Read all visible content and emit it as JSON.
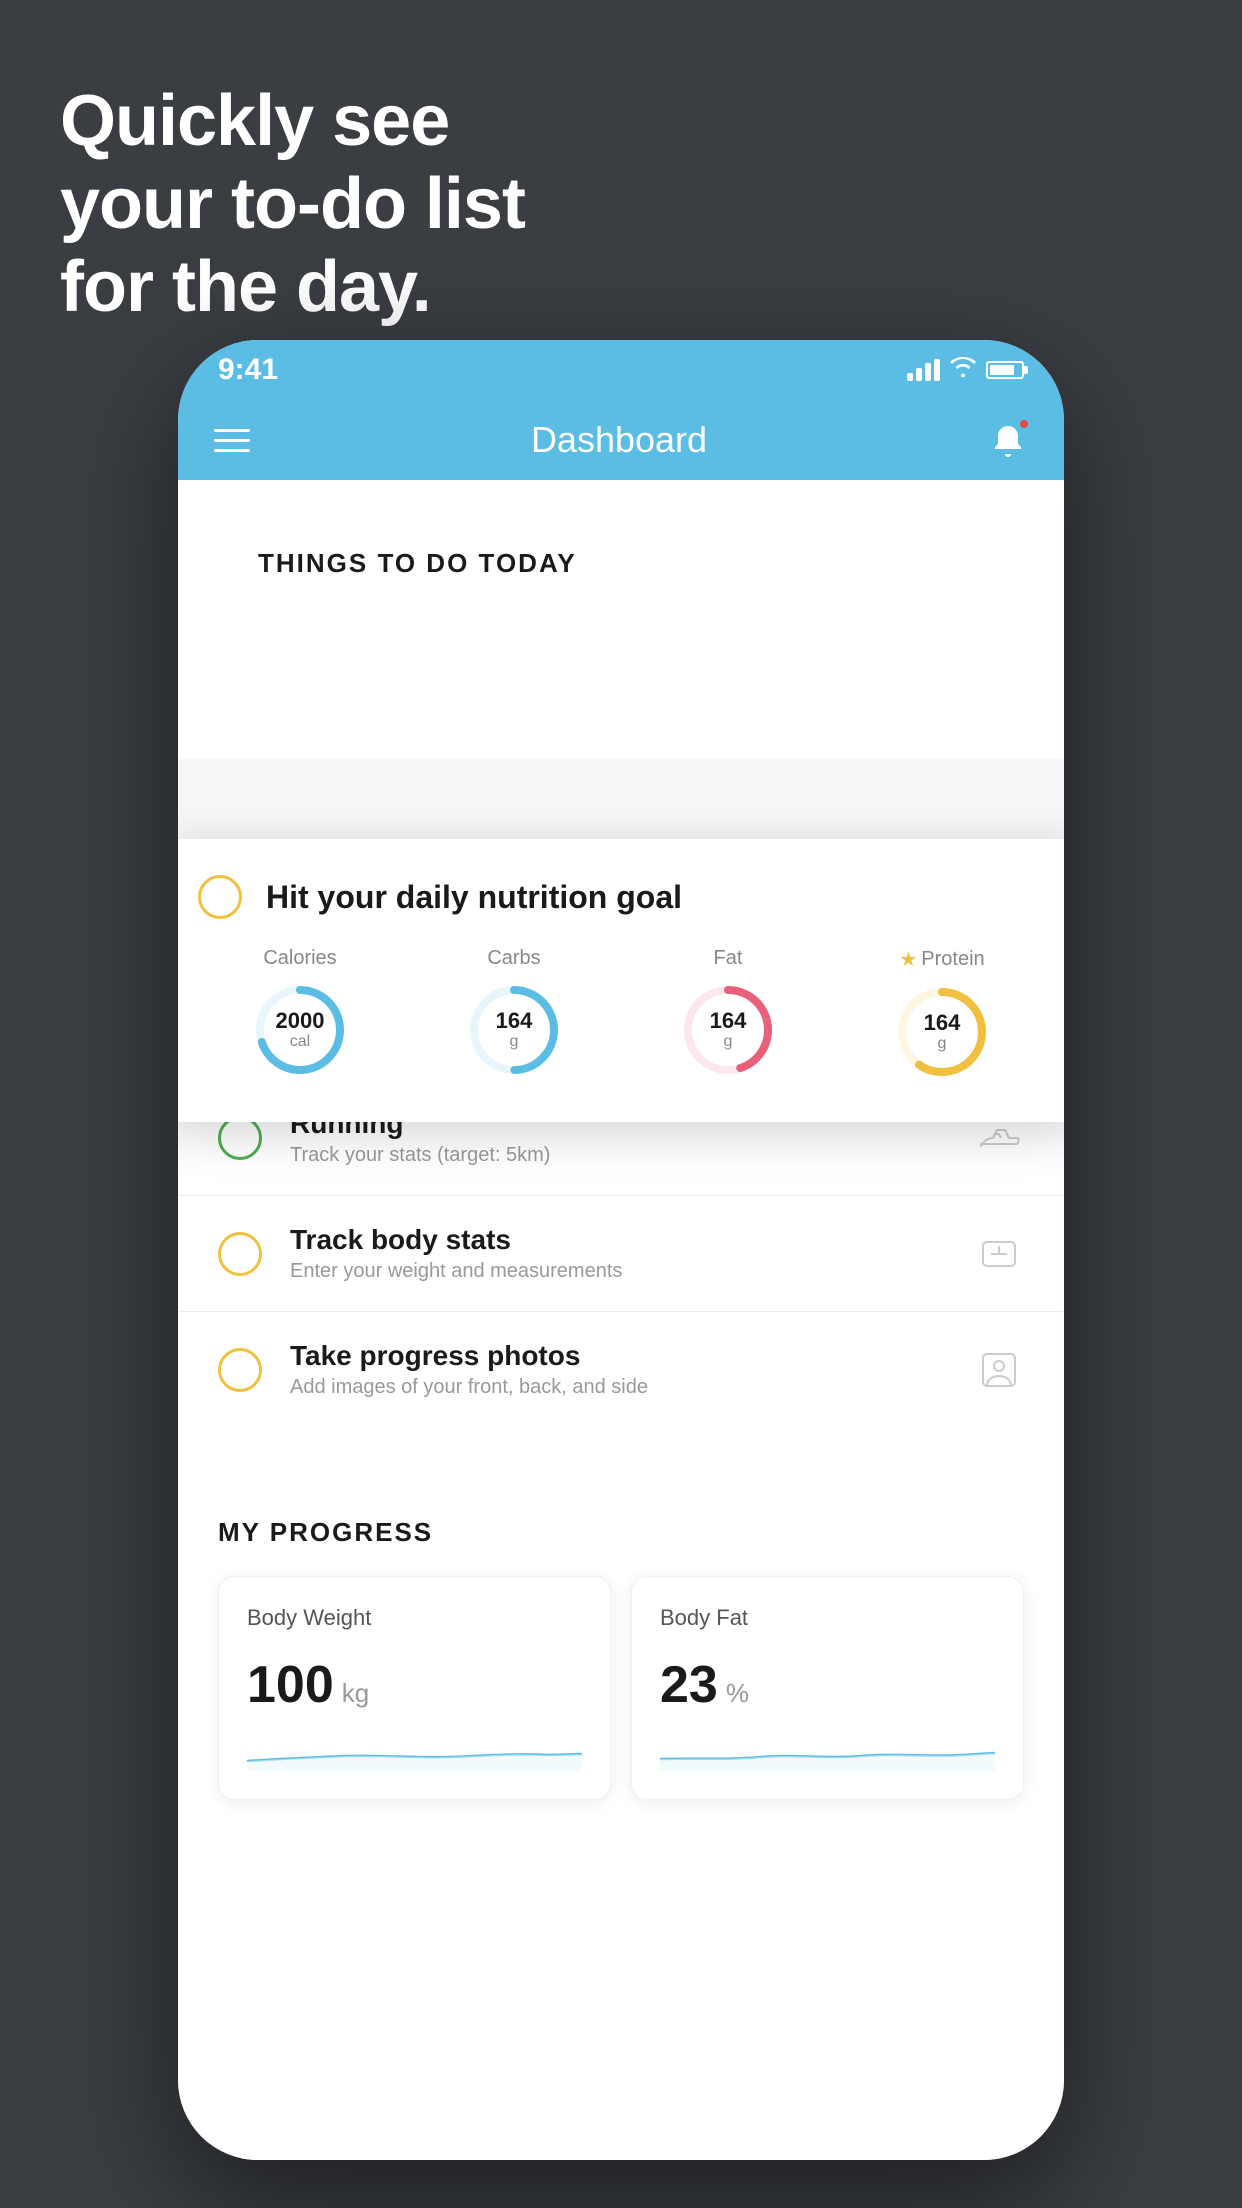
{
  "headline": {
    "line1": "Quickly see",
    "line2": "your to-do list",
    "line3": "for the day."
  },
  "status_bar": {
    "time": "9:41"
  },
  "nav": {
    "title": "Dashboard"
  },
  "section_today": {
    "label": "THINGS TO DO TODAY"
  },
  "floating_card": {
    "title": "Hit your daily nutrition goal",
    "nutrients": [
      {
        "label": "Calories",
        "value": "2000",
        "unit": "cal",
        "color": "#5bbce4",
        "track_pct": 0.7
      },
      {
        "label": "Carbs",
        "value": "164",
        "unit": "g",
        "color": "#5bbce4",
        "track_pct": 0.5
      },
      {
        "label": "Fat",
        "value": "164",
        "unit": "g",
        "color": "#e8607a",
        "track_pct": 0.45
      },
      {
        "label": "Protein",
        "value": "164",
        "unit": "g",
        "color": "#f0c040",
        "track_pct": 0.6,
        "starred": true
      }
    ]
  },
  "todo_items": [
    {
      "name": "Running",
      "sub": "Track your stats (target: 5km)",
      "circle_color": "green",
      "icon": "shoe"
    },
    {
      "name": "Track body stats",
      "sub": "Enter your weight and measurements",
      "circle_color": "orange",
      "icon": "scale"
    },
    {
      "name": "Take progress photos",
      "sub": "Add images of your front, back, and side",
      "circle_color": "orange",
      "icon": "person"
    }
  ],
  "progress": {
    "section_label": "MY PROGRESS",
    "cards": [
      {
        "title": "Body Weight",
        "value": "100",
        "unit": "kg"
      },
      {
        "title": "Body Fat",
        "value": "23",
        "unit": "%"
      }
    ]
  }
}
